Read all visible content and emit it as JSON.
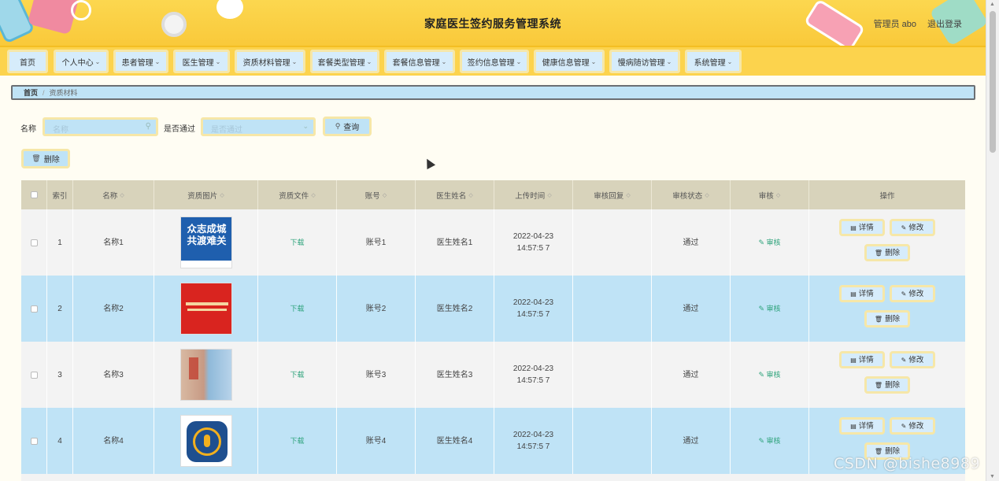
{
  "app": {
    "title": "家庭医生签约服务管理系统",
    "user_label": "管理员 abo",
    "logout_label": "退出登录"
  },
  "nav": [
    {
      "label": "首页",
      "has_dropdown": false
    },
    {
      "label": "个人中心",
      "has_dropdown": true
    },
    {
      "label": "患者管理",
      "has_dropdown": true
    },
    {
      "label": "医生管理",
      "has_dropdown": true
    },
    {
      "label": "资质材料管理",
      "has_dropdown": true
    },
    {
      "label": "套餐类型管理",
      "has_dropdown": true
    },
    {
      "label": "套餐信息管理",
      "has_dropdown": true
    },
    {
      "label": "签约信息管理",
      "has_dropdown": true
    },
    {
      "label": "健康信息管理",
      "has_dropdown": true
    },
    {
      "label": "慢病随访管理",
      "has_dropdown": true
    },
    {
      "label": "系统管理",
      "has_dropdown": true
    }
  ],
  "breadcrumb": {
    "home": "首页",
    "separator": "/",
    "current": "资质材料"
  },
  "filters": {
    "name_label": "名称",
    "name_placeholder": "名称",
    "approved_label": "是否通过",
    "approved_placeholder": "是否通过",
    "query_button": "查询"
  },
  "toolbar": {
    "delete_button": "删除"
  },
  "table": {
    "columns": [
      "索引",
      "名称",
      "资质图片",
      "资质文件",
      "账号",
      "医生姓名",
      "上传时间",
      "审核回复",
      "审核状态",
      "审核",
      "操作"
    ],
    "rows": [
      {
        "index": "1",
        "name": "名称1",
        "image_text": "众志成城\n共渡难关",
        "file_link": "下载",
        "account": "账号1",
        "doctor": "医生姓名1",
        "upload_time": "2022-04-23 14:57:5 7",
        "reply": "",
        "status": "通过",
        "audit": "审核"
      },
      {
        "index": "2",
        "name": "名称2",
        "image_text": "",
        "file_link": "下载",
        "account": "账号2",
        "doctor": "医生姓名2",
        "upload_time": "2022-04-23 14:57:5 7",
        "reply": "",
        "status": "通过",
        "audit": "审核"
      },
      {
        "index": "3",
        "name": "名称3",
        "image_text": "",
        "file_link": "下载",
        "account": "账号3",
        "doctor": "医生姓名3",
        "upload_time": "2022-04-23 14:57:5 7",
        "reply": "",
        "status": "通过",
        "audit": "审核"
      },
      {
        "index": "4",
        "name": "名称4",
        "image_text": "",
        "file_link": "下载",
        "account": "账号4",
        "doctor": "医生姓名4",
        "upload_time": "2022-04-23 14:57:5 7",
        "reply": "",
        "status": "通过",
        "audit": "审核"
      }
    ],
    "row_actions": {
      "detail": "详情",
      "edit": "修改",
      "delete": "删除"
    }
  },
  "watermark": "CSDN @bishe8989",
  "icons": {
    "search": "search-icon",
    "dropdown": "chevron-down-icon",
    "delete": "trash-icon",
    "detail": "document-icon",
    "edit": "pencil-icon",
    "sort": "sort-icon"
  },
  "colors": {
    "header_bg": "#fcd34d",
    "nav_item_bg": "#d6ecfb",
    "row_alt_bg": "#bfe3f6",
    "table_head_bg": "#d8d3bb",
    "link_green": "#2fa37c"
  }
}
